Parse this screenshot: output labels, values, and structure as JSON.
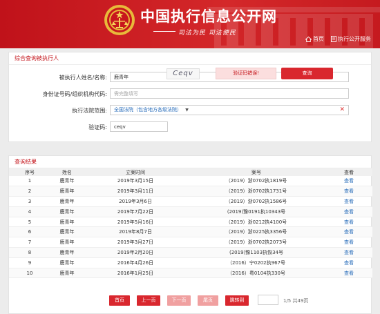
{
  "header": {
    "site_title": "中国执行信息公开网",
    "slogan": "司法为民  司法便民",
    "nav_home": "首页",
    "nav_service": "执行公开服务"
  },
  "search": {
    "title": "综合查询被执行人",
    "name_label": "被执行人姓名/名称:",
    "name_value": "鹿青年",
    "id_label": "身份证号码/组织机构代码:",
    "id_placeholder": "需完整填写",
    "court_label": "执行法院范围:",
    "court_value": "全国法院（包含地方各级法院）",
    "captcha_label": "验证码:",
    "captcha_value": "ceqv",
    "captcha_image_text": "Ceqv",
    "captcha_error": "验证码错误!",
    "search_button": "查询"
  },
  "results": {
    "title": "查询结果",
    "columns": [
      "序号",
      "姓名",
      "立案时间",
      "案号",
      "查看"
    ],
    "rows": [
      {
        "no": "1",
        "name": "鹿青年",
        "date": "2019年3月15日",
        "case": "（2019）浙0702执1819号",
        "view": "查看"
      },
      {
        "no": "2",
        "name": "鹿青年",
        "date": "2019年3月11日",
        "case": "（2019）浙0702执1731号",
        "view": "查看"
      },
      {
        "no": "3",
        "name": "鹿青年",
        "date": "2019年3月6日",
        "case": "（2019）浙0702执1586号",
        "view": "查看"
      },
      {
        "no": "4",
        "name": "鹿青年",
        "date": "2019年7月22日",
        "case": "(2019)豫0191执10343号",
        "view": "查看"
      },
      {
        "no": "5",
        "name": "鹿青年",
        "date": "2019年5月16日",
        "case": "（2019）浙0212执4100号",
        "view": "查看"
      },
      {
        "no": "6",
        "name": "鹿青年",
        "date": "2019年8月7日",
        "case": "（2019）浙0225执3356号",
        "view": "查看"
      },
      {
        "no": "7",
        "name": "鹿青年",
        "date": "2019年3月27日",
        "case": "（2019）浙0702执2073号",
        "view": "查看"
      },
      {
        "no": "8",
        "name": "鹿青年",
        "date": "2019年2月20日",
        "case": "(2019)豫1103执恢34号",
        "view": "查看"
      },
      {
        "no": "9",
        "name": "鹿青年",
        "date": "2016年4月26日",
        "case": "（2016）宁0202执967号",
        "view": "查看"
      },
      {
        "no": "10",
        "name": "鹿青年",
        "date": "2016年1月25日",
        "case": "（2016）粤0104执330号",
        "view": "查看"
      }
    ]
  },
  "pager": {
    "first": "首页",
    "prev": "上一页",
    "next": "下一页",
    "last": "尾页",
    "jump": "跳转到",
    "info": "1/5 共49页"
  },
  "colors": {
    "brand_red": "#c4161c",
    "button_red": "#d9272e",
    "link_blue": "#2a6ebb",
    "pager_enabled": "#d9272e",
    "pager_disabled": "#f0a0a0"
  }
}
